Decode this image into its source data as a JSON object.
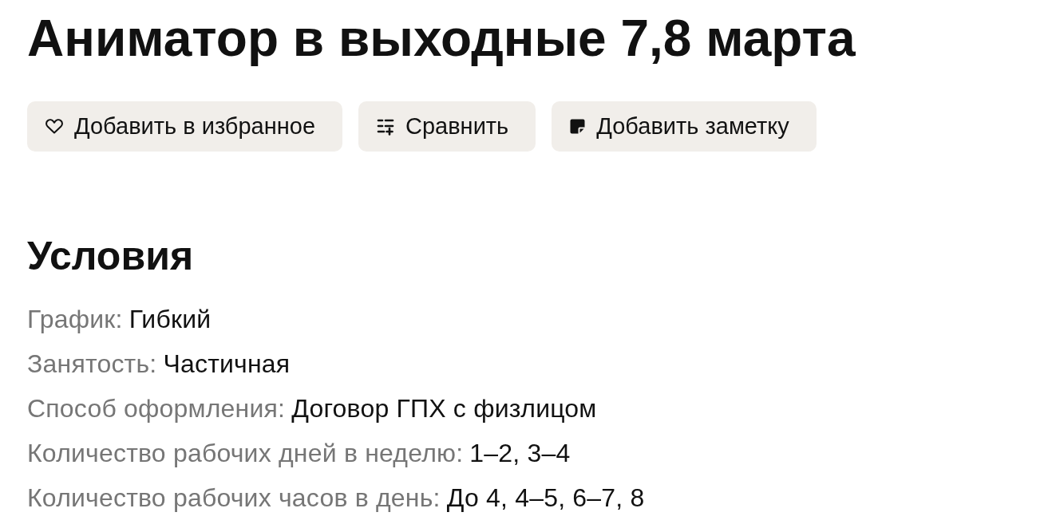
{
  "title": "Аниматор в выходные 7,8 марта",
  "actions": [
    {
      "kind": "favorite",
      "label": "Добавить в избранное"
    },
    {
      "kind": "compare",
      "label": "Сравнить"
    },
    {
      "kind": "note",
      "label": "Добавить заметку"
    }
  ],
  "conditions": {
    "heading": "Условия",
    "items": [
      {
        "label": "График:",
        "value": "Гибкий"
      },
      {
        "label": "Занятость:",
        "value": "Частичная"
      },
      {
        "label": "Способ оформления:",
        "value": "Договор ГПХ с физлицом"
      },
      {
        "label": "Количество рабочих дней в неделю:",
        "value": "1–2, 3–4"
      },
      {
        "label": "Количество рабочих часов в день:",
        "value": "До 4, 4–5, 6–7, 8"
      }
    ]
  }
}
